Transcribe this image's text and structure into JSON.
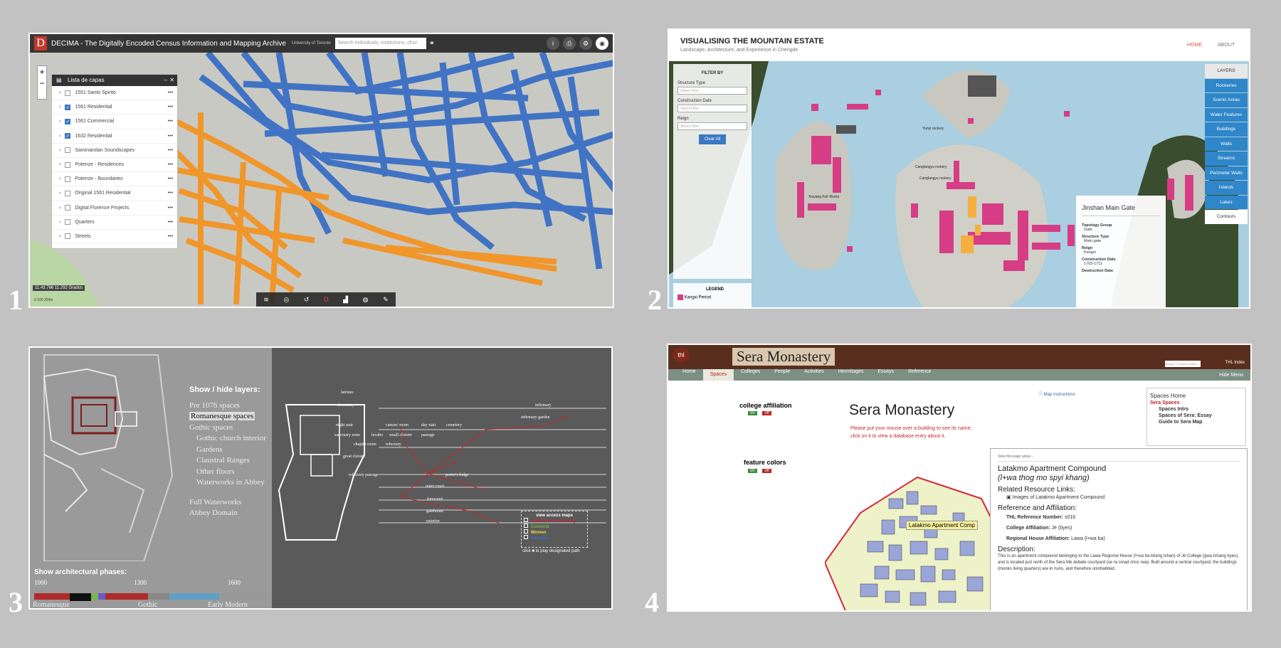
{
  "panel1": {
    "number": "1",
    "app_title": "DECIMA - The Digitally Encoded Census Information and Mapping Archive",
    "institution": "University of Toronto",
    "search_placeholder": "Search individuals, institutions, chur",
    "layers_title": "Lista de capas",
    "layers": [
      {
        "label": "1551 Santo Spirito",
        "checked": false
      },
      {
        "label": "1561 Residential",
        "checked": true
      },
      {
        "label": "1561 Commercial",
        "checked": true
      },
      {
        "label": "1632 Residential",
        "checked": true
      },
      {
        "label": "Savonarolan Soundscapes",
        "checked": false
      },
      {
        "label": "Potenze - Residences",
        "checked": false
      },
      {
        "label": "Potenze - Boundaries",
        "checked": false
      },
      {
        "label": "Original 1561 Residential",
        "checked": false
      },
      {
        "label": "Digital Florence Projects",
        "checked": false
      },
      {
        "label": "Quarters",
        "checked": false
      },
      {
        "label": "Streets",
        "checked": false
      }
    ],
    "coords": "11.43.766 11.292 Grados",
    "scale": "0     100     200m",
    "colors": {
      "residential": "#3a6fc4",
      "commercial": "#f0962a"
    }
  },
  "panel2": {
    "number": "2",
    "title": "VISUALISING THE MOUNTAIN ESTATE",
    "subtitle": "Landscape, Architecture, and Experience in Chengde",
    "nav_home": "HOME",
    "nav_about": "ABOUT",
    "filter_title": "FILTER BY",
    "filters": [
      {
        "label": "Structure Type",
        "placeholder": "Select Here"
      },
      {
        "label": "Construction Date",
        "placeholder": "Select Here"
      },
      {
        "label": "Reign",
        "placeholder": "Select Here"
      }
    ],
    "clear_label": "Clear All",
    "legend_title": "LEGEND",
    "legend_item": "Kangxi Period",
    "layers_title": "LAYERS",
    "layers": [
      "Rockeries",
      "Scenic Areas",
      "Water Features",
      "Buildings",
      "Walls",
      "Streams",
      "Perimeter Walls",
      "Islands",
      "Lakes",
      "Contours"
    ],
    "map_labels": [
      "Yunyi rockery",
      "Canglangyu rockery",
      "Canglangyu rockery",
      "Xiuyang Fuh Rocks"
    ],
    "info": {
      "title": "Jinshan Main Gate",
      "fields": [
        {
          "label": "Topology Group",
          "value": "Gate"
        },
        {
          "label": "Structure Type",
          "value": "Main gate"
        },
        {
          "label": "Reign",
          "value": "Kangxi"
        },
        {
          "label": "Construction Date",
          "value": "1703-1711"
        },
        {
          "label": "Destruction Date",
          "value": ""
        }
      ]
    },
    "colors": {
      "building": "#d63d85",
      "highlight": "#f5b042",
      "water": "#a9cfe0",
      "layer_button": "#2f86c8"
    }
  },
  "panel3": {
    "number": "3",
    "show_layers_title": "Show / hide layers:",
    "layers": [
      "Pre 1076 spaces",
      "Romanesque spaces",
      "Gothic spaces",
      "Gothic church interior",
      "Gardens",
      "Claustral Ranges",
      "Other floors",
      "Waterworks  in Abbey"
    ],
    "highlighted_layer": "Romanesque spaces",
    "extra_layers": [
      "Full Waterworks",
      "Abbey Domain"
    ],
    "phases_title": "Show architectural phases:",
    "years": [
      "1000",
      "1300",
      "1600"
    ],
    "eras": [
      "Romanesque",
      "Gothic",
      "Early Modern"
    ],
    "plan_labels": [
      "latrines",
      "dormitory",
      "infirmary",
      "infirmary garden",
      "night stair",
      "canons' room",
      "day stair",
      "cemetery",
      "sanctuary zone",
      "lavabo",
      "small cloister",
      "passage",
      "chapter room",
      "refectory",
      "great cloister",
      "refectory passage",
      "porter's lodge",
      "outer court",
      "forecourt",
      "gatehouse",
      "exterior"
    ],
    "view_maps_title": "view access maps",
    "view_maps": [
      "Canonical Community",
      "Conversi",
      "Women",
      "Servants"
    ],
    "click_text": "click  ■  to play designated path",
    "colors": {
      "plan": "#ffffff",
      "path": "#c0282b"
    }
  },
  "panel4": {
    "number": "4",
    "site_logo": "thl",
    "title": "Sera Monastery",
    "search_placeholder": "Google™ Custom Search",
    "top_link": "THL Index",
    "hide_menu": "Hide Menu",
    "menu": [
      "Home",
      "Spaces",
      "Colleges",
      "People",
      "Activities",
      "Hermitages",
      "Essays",
      "Reference"
    ],
    "active_menu": "Spaces",
    "college_affiliation": "college affiliation",
    "feature_colors": "feature colors",
    "on": "on",
    "off": "off",
    "map_instructions": "Map Instructions",
    "heading": "Sera Monastery",
    "instruction_line1": "Please put your mouse over a building to see its name;",
    "instruction_line2": "click on it to view a database entry about it.",
    "sidebar": [
      "Spaces Home",
      "Sera Spaces",
      "Spaces Intro",
      "Spaces of Sera: Essay",
      "Guide to Sera Map"
    ],
    "popup": {
      "view_page": "View this page alone...",
      "title": "Latakmo Apartment Compound",
      "subtitle": "(l+wa thog mo spyi khang)",
      "related_title": "Related Resource Links:",
      "related_link": "Images of Latakmo Apartment Compound",
      "ref_title": "Reference and Affiliation:",
      "thl_ref_label": "THL Reference Number:",
      "thl_ref_value": "s016",
      "college_label": "College Affiliation:",
      "college_value": "Jé (byes)",
      "regional_label": "Regional House Affiliation:",
      "regional_value": "Lawa (l+wa ba)",
      "description_title": "Description:",
      "description": "This is an apartment compound belonging to the Lawa Regional House (l+wa ba khang tshan) of Jé College (gwa tshang byes), and is located just north of the Sera Mé debate courtyard (se ra smad chos rwa). Built around a central courtyard, the buildings (monks living quarters) are in ruins, and therefore uninhabited."
    },
    "tooltip": "Latakmo Apartment Comp",
    "colors": {
      "building": "#9aa6d8",
      "boundary": "#d9263a",
      "active_tab": "#b22222"
    }
  }
}
